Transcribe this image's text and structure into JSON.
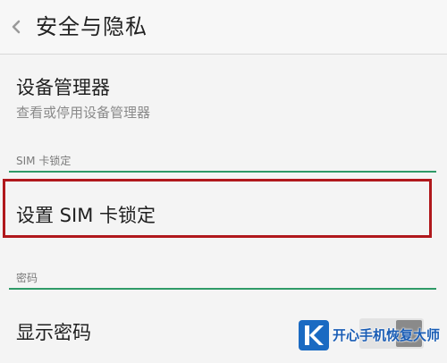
{
  "header": {
    "title": "安全与隐私",
    "back_icon": "chevron-left-icon"
  },
  "device_manager": {
    "title": "设备管理器",
    "subtitle": "查看或停用设备管理器"
  },
  "sim_lock_section": {
    "label": "SIM 卡锁定",
    "item_title": "设置 SIM 卡锁定"
  },
  "password_section": {
    "label": "密码",
    "show_password_title": "显示密码",
    "show_password_enabled": false
  },
  "watermark": {
    "logo_letter": "K",
    "text": "开心手机恢复大师"
  },
  "colors": {
    "accent_divider": "#2f9a67",
    "highlight_border": "#b0181c",
    "watermark_blue": "#1a6ac2"
  }
}
